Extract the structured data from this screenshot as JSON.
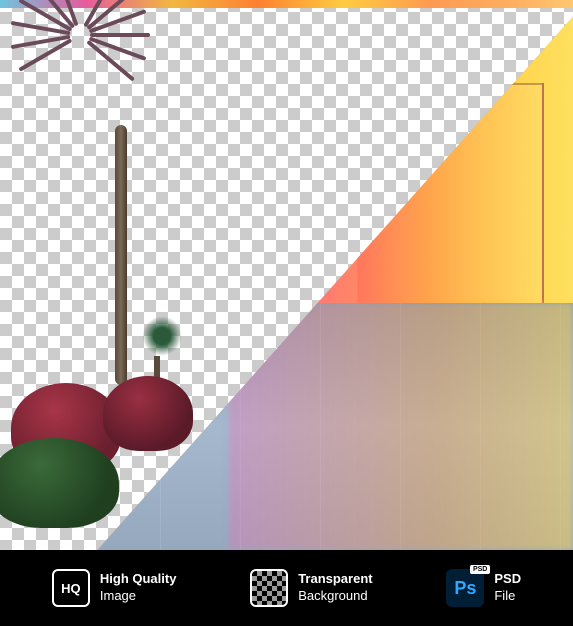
{
  "hq_badge": "HQ",
  "features": {
    "high_quality": {
      "line1": "High Quality",
      "line2": "Image"
    },
    "transparent": {
      "line1": "Transparent",
      "line2": "Background"
    },
    "psd": {
      "line1": "PSD",
      "line2": "File",
      "badge": "PSD",
      "ps_label": "Ps"
    }
  }
}
